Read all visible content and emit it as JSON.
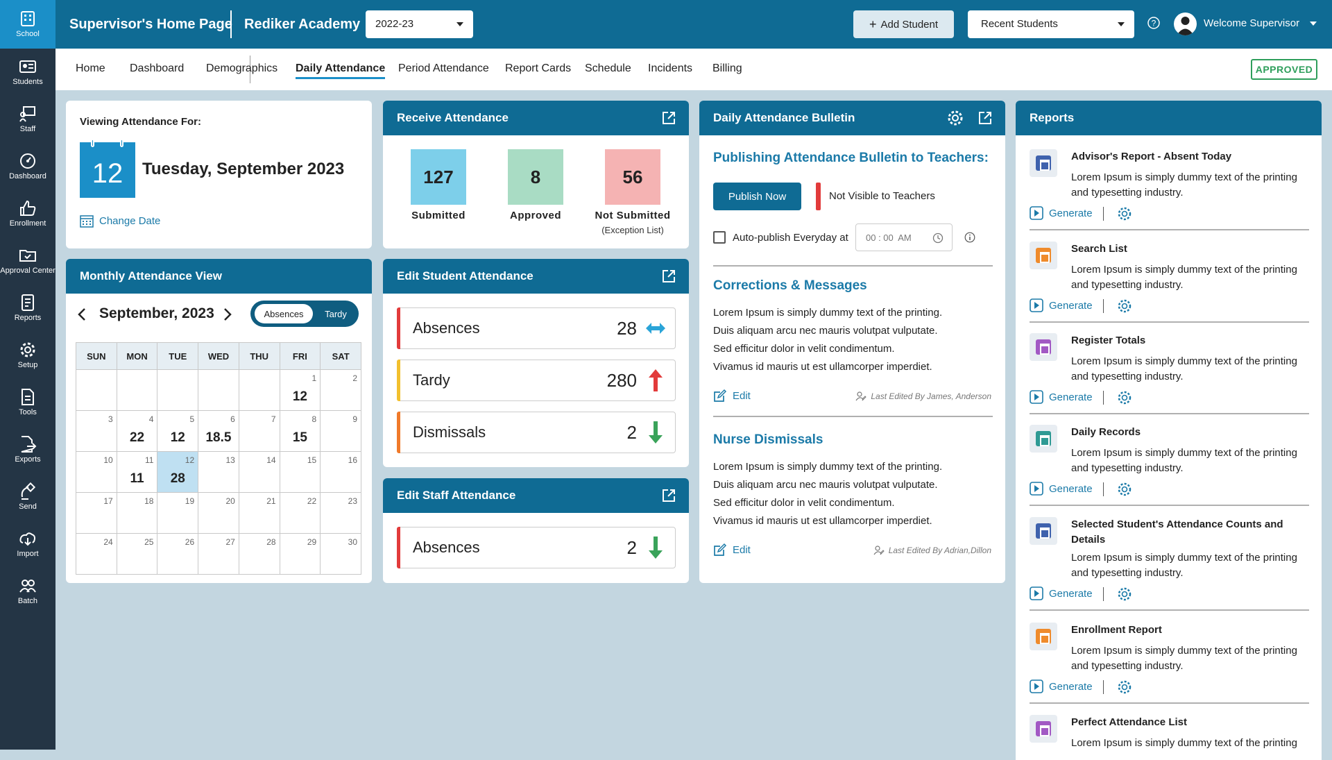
{
  "sidebar": {
    "items": [
      {
        "label": "School",
        "icon": "school-icon"
      },
      {
        "label": "Students",
        "icon": "id-card-icon"
      },
      {
        "label": "Staff",
        "icon": "staff-board-icon"
      },
      {
        "label": "Dashboard",
        "icon": "dashboard-icon"
      },
      {
        "label": "Enrollment",
        "icon": "thumbs-up-icon"
      },
      {
        "label": "Approval Center",
        "icon": "folder-check-icon"
      },
      {
        "label": "Reports",
        "icon": "report-icon"
      },
      {
        "label": "Setup",
        "icon": "gear-icon"
      },
      {
        "label": "Tools",
        "icon": "document-icon"
      },
      {
        "label": "Exports",
        "icon": "export-icon"
      },
      {
        "label": "Send",
        "icon": "satellite-icon"
      },
      {
        "label": "Import",
        "icon": "cloud-download-icon"
      },
      {
        "label": "Batch",
        "icon": "group-icon"
      }
    ]
  },
  "topbar": {
    "title": "Supervisor's Home Page",
    "school": "Rediker Academy",
    "year": "2022-23",
    "add_student": "Add Student",
    "recent_students": "Recent Students",
    "welcome": "Welcome Supervisor"
  },
  "nav": {
    "items": [
      "Home",
      "Dashboard",
      "Demographics",
      "Daily Attendance",
      "Period Attendance",
      "Report Cards",
      "Schedule",
      "Incidents",
      "Billing"
    ],
    "active": "Daily Attendance",
    "status": "APPROVED"
  },
  "viewing": {
    "label": "Viewing Attendance For:",
    "day": "12",
    "date": "Tuesday, September 2023",
    "change_date": "Change Date"
  },
  "receive": {
    "title": "Receive Attendance",
    "stats": [
      {
        "value": "127",
        "label": "Submitted",
        "sub": "",
        "color": "#7dcfea"
      },
      {
        "value": "8",
        "label": "Approved",
        "sub": "",
        "color": "#a9dcc4"
      },
      {
        "value": "56",
        "label": "Not Submitted",
        "sub": "(Exception List)",
        "color": "#f5b3b3"
      }
    ]
  },
  "monthly": {
    "title": "Monthly Attendance View",
    "month": "September, 2023",
    "toggle_on": "Absences",
    "toggle_off": "Tardy",
    "weekdays": [
      "SUN",
      "MON",
      "TUE",
      "WED",
      "THU",
      "FRI",
      "SAT"
    ],
    "weeks": [
      [
        {
          "d": "",
          "v": ""
        },
        {
          "d": "",
          "v": ""
        },
        {
          "d": "",
          "v": ""
        },
        {
          "d": "",
          "v": ""
        },
        {
          "d": "",
          "v": ""
        },
        {
          "d": "1",
          "v": "12"
        },
        {
          "d": "2",
          "v": ""
        }
      ],
      [
        {
          "d": "3",
          "v": ""
        },
        {
          "d": "4",
          "v": "22"
        },
        {
          "d": "5",
          "v": "12"
        },
        {
          "d": "6",
          "v": "18.5"
        },
        {
          "d": "7",
          "v": ""
        },
        {
          "d": "8",
          "v": "15"
        },
        {
          "d": "9",
          "v": ""
        }
      ],
      [
        {
          "d": "10",
          "v": ""
        },
        {
          "d": "11",
          "v": "11"
        },
        {
          "d": "12",
          "v": "28",
          "sel": true
        },
        {
          "d": "13",
          "v": ""
        },
        {
          "d": "14",
          "v": ""
        },
        {
          "d": "15",
          "v": ""
        },
        {
          "d": "16",
          "v": ""
        }
      ],
      [
        {
          "d": "17",
          "v": ""
        },
        {
          "d": "18",
          "v": ""
        },
        {
          "d": "19",
          "v": ""
        },
        {
          "d": "20",
          "v": ""
        },
        {
          "d": "21",
          "v": ""
        },
        {
          "d": "22",
          "v": ""
        },
        {
          "d": "23",
          "v": ""
        }
      ],
      [
        {
          "d": "24",
          "v": ""
        },
        {
          "d": "25",
          "v": ""
        },
        {
          "d": "26",
          "v": ""
        },
        {
          "d": "27",
          "v": ""
        },
        {
          "d": "28",
          "v": ""
        },
        {
          "d": "29",
          "v": ""
        },
        {
          "d": "30",
          "v": ""
        }
      ]
    ]
  },
  "edit_student": {
    "title": "Edit Student Attendance",
    "rows": [
      {
        "label": "Absences",
        "value": "28",
        "color": "#e23b3b",
        "icon": "two-way-arrow-icon"
      },
      {
        "label": "Tardy",
        "value": "280",
        "color": "#f2c02e",
        "icon": "arrow-up-icon"
      },
      {
        "label": "Dismissals",
        "value": "2",
        "color": "#f07a2a",
        "icon": "arrow-down-icon"
      }
    ]
  },
  "edit_staff": {
    "title": "Edit Staff Attendance",
    "rows": [
      {
        "label": "Absences",
        "value": "2",
        "color": "#e23b3b",
        "icon": "arrow-down-icon"
      }
    ]
  },
  "bulletin": {
    "title": "Daily Attendance Bulletin",
    "publishing_heading": "Publishing Attendance Bulletin to Teachers:",
    "publish_now": "Publish Now",
    "not_visible": "Not Visible to Teachers",
    "auto_publish": "Auto-publish Everyday at",
    "time": "00 : 00  AM",
    "corrections_heading": "Corrections & Messages",
    "corrections_text": [
      "Lorem Ipsum is simply dummy text of the printing.",
      "Duis aliquam arcu nec mauris volutpat vulputate.",
      "Sed efficitur dolor in velit condimentum.",
      "Vivamus id mauris ut est ullamcorper imperdiet."
    ],
    "edit": "Edit",
    "corrections_last": "Last Edited By James, Anderson",
    "nurse_heading": "Nurse Dismissals",
    "nurse_text": [
      "Lorem Ipsum is simply dummy text of the printing.",
      "Duis aliquam arcu nec mauris volutpat vulputate.",
      "Sed efficitur dolor in velit condimentum.",
      "Vivamus id mauris ut est ullamcorper imperdiet."
    ],
    "nurse_last": "Last Edited By Adrian,Dillon"
  },
  "reports": {
    "title": "Reports",
    "generate": "Generate",
    "items": [
      {
        "title": "Advisor's Report - Absent Today",
        "desc": "Lorem Ipsum is simply dummy text of the printing and typesetting industry.",
        "color": "#3f62ad"
      },
      {
        "title": "Search List",
        "desc": "Lorem Ipsum is simply dummy text of the printing and typesetting industry.",
        "color": "#ef8b2c"
      },
      {
        "title": "Register Totals",
        "desc": "Lorem Ipsum is simply dummy text of the printing and typesetting industry.",
        "color": "#a259c4"
      },
      {
        "title": "Daily Records",
        "desc": "Lorem Ipsum is simply dummy text of the printing and typesetting industry.",
        "color": "#2f9a94"
      },
      {
        "title": "Selected Student's Attendance Counts and Details",
        "desc": "Lorem Ipsum is simply dummy text of the printing and typesetting industry.",
        "color": "#3f62ad"
      },
      {
        "title": "Enrollment Report",
        "desc": "Lorem Ipsum is simply dummy text of the printing and typesetting industry.",
        "color": "#ef8b2c"
      },
      {
        "title": "Perfect Attendance List",
        "desc": "Lorem Ipsum is simply dummy text of the printing",
        "color": "#a259c4"
      }
    ]
  }
}
